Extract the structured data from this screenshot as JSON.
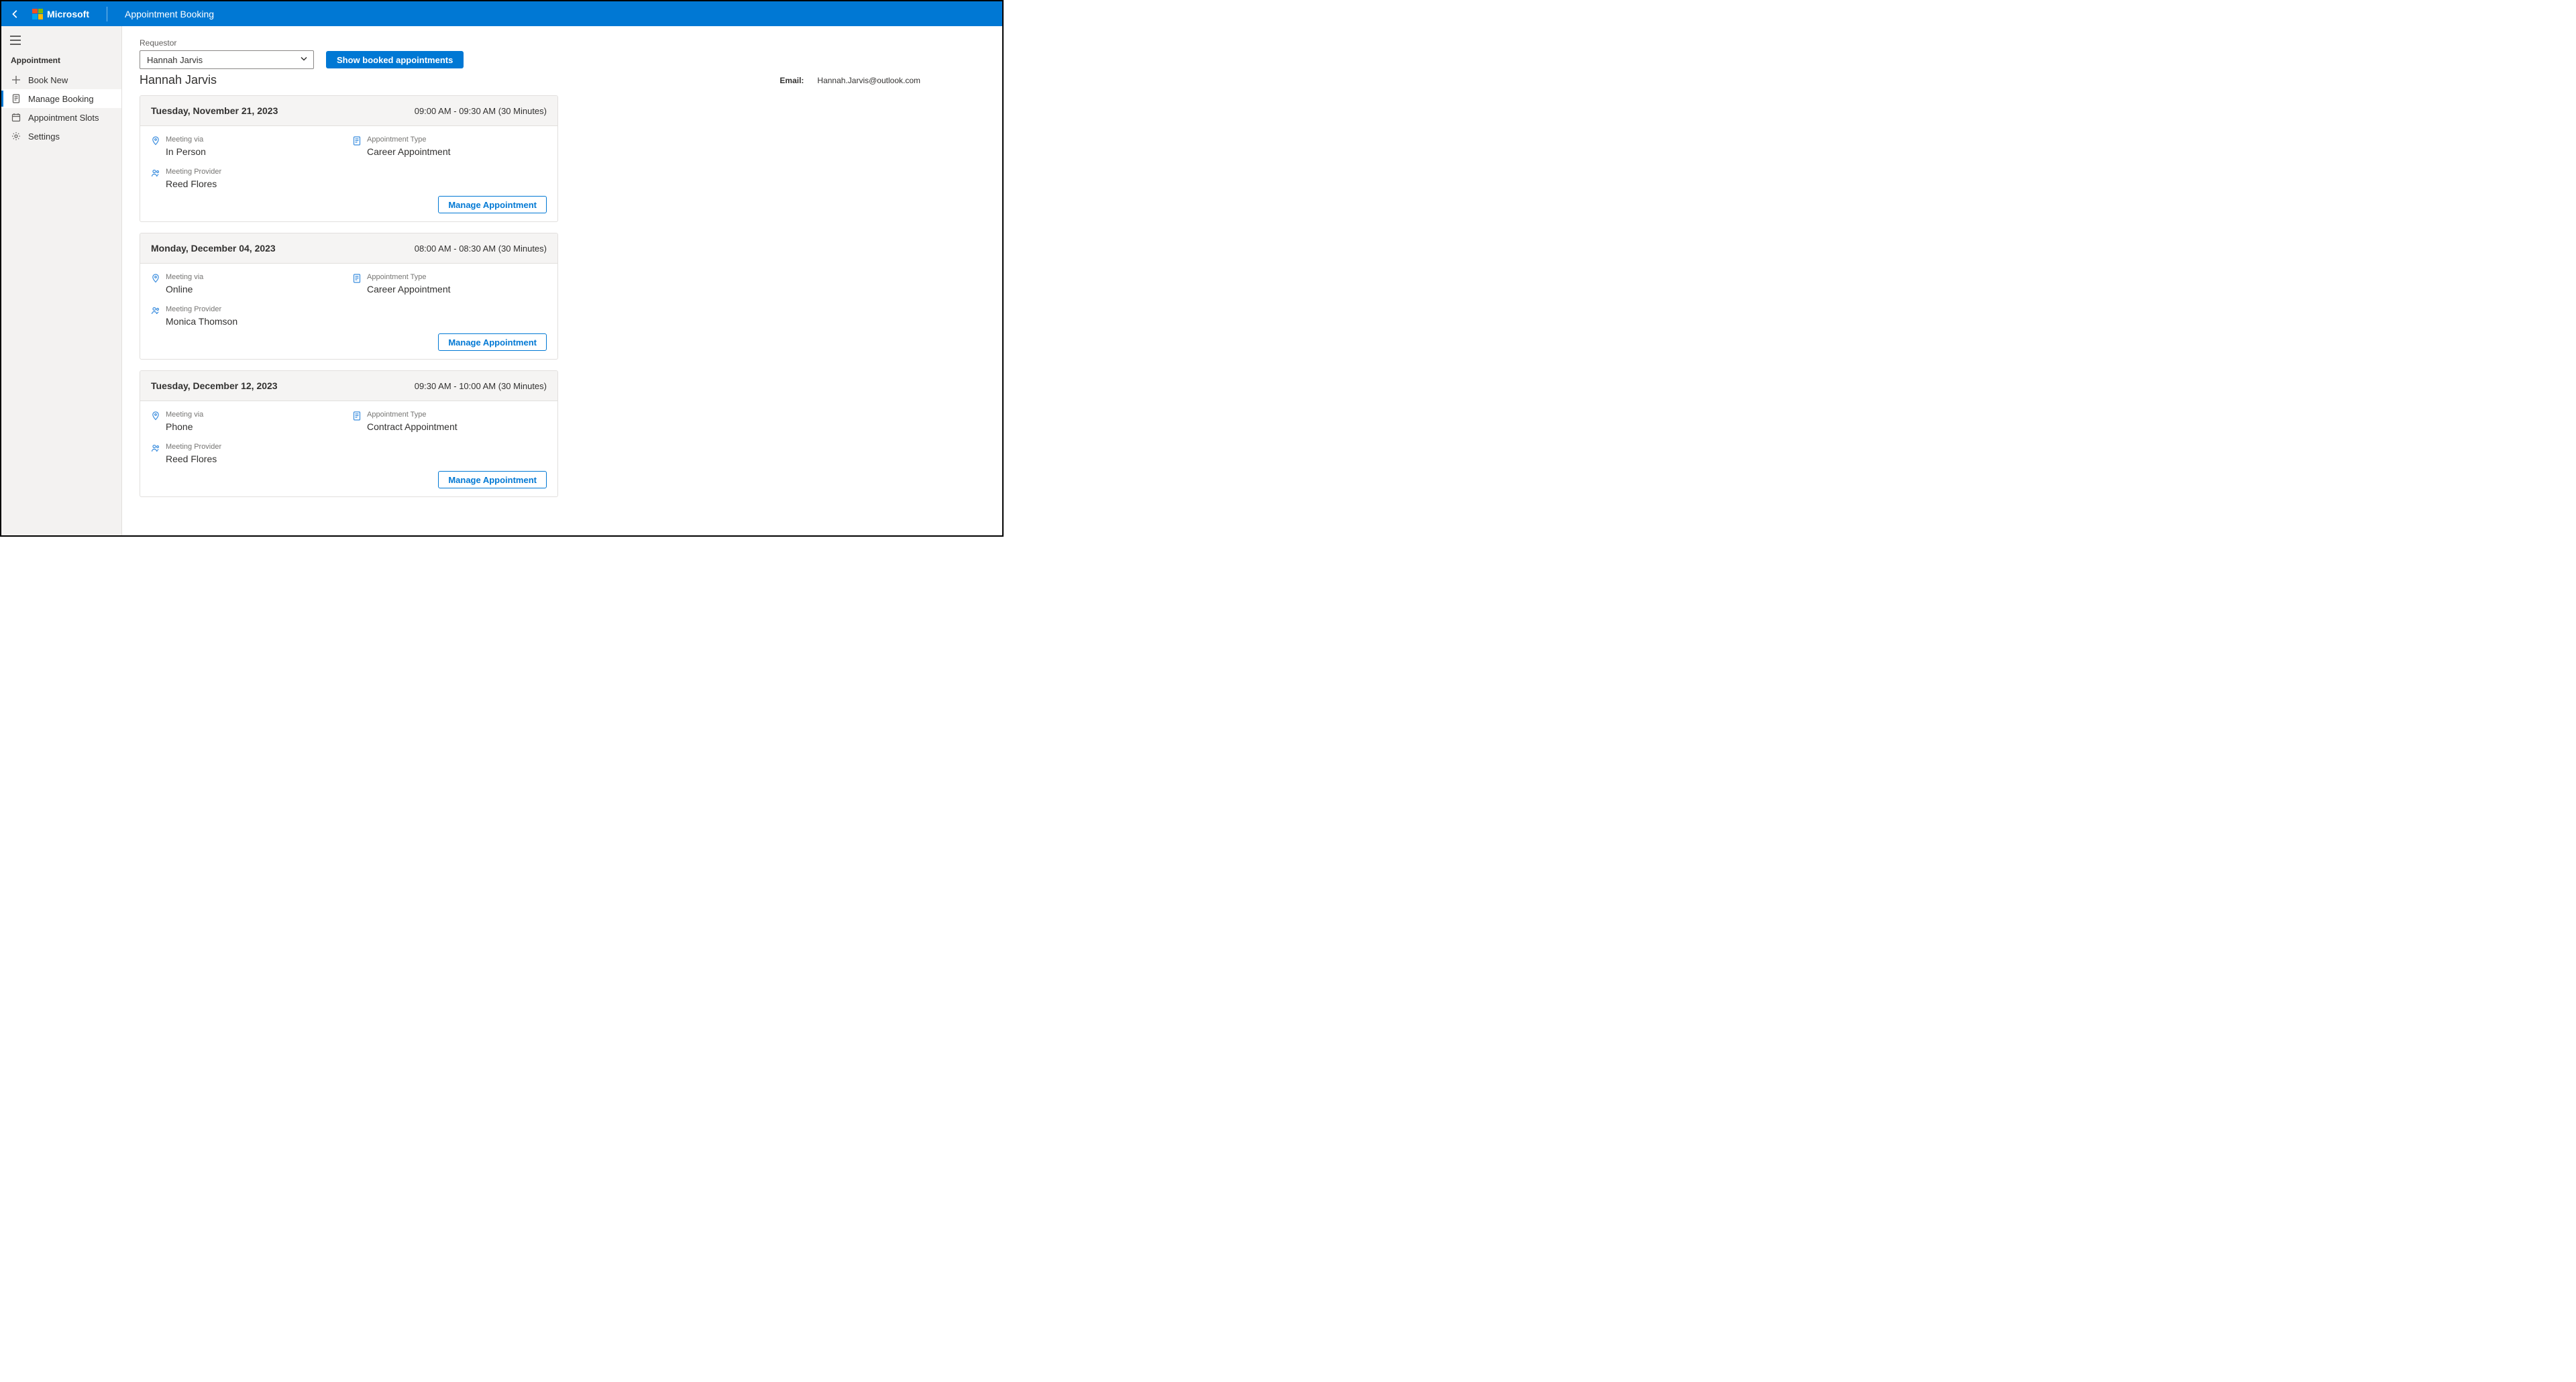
{
  "header": {
    "brand": "Microsoft",
    "app_title": "Appointment Booking"
  },
  "sidebar": {
    "group_label": "Appointment",
    "items": [
      {
        "icon": "plus",
        "label": "Book New"
      },
      {
        "icon": "document",
        "label": "Manage Booking"
      },
      {
        "icon": "calendar",
        "label": "Appointment Slots"
      },
      {
        "icon": "gear",
        "label": "Settings"
      }
    ]
  },
  "main": {
    "requestor_label": "Requestor",
    "requestor_select": "Hannah Jarvis",
    "show_booked_btn": "Show booked appointments",
    "requestor_name": "Hannah Jarvis",
    "email_label": "Email:",
    "email_value": "Hannah.Jarvis@outlook.com",
    "field_labels": {
      "meeting_via": "Meeting via",
      "appointment_type": "Appointment Type",
      "meeting_provider": "Meeting Provider"
    },
    "manage_btn": "Manage Appointment",
    "cards": [
      {
        "date": "Tuesday, November 21, 2023",
        "time": "09:00 AM - 09:30 AM (30 Minutes)",
        "meeting_via": "In Person",
        "appointment_type": "Career Appointment",
        "meeting_provider": "Reed Flores"
      },
      {
        "date": "Monday, December 04, 2023",
        "time": "08:00 AM - 08:30 AM (30 Minutes)",
        "meeting_via": "Online",
        "appointment_type": "Career Appointment",
        "meeting_provider": "Monica Thomson"
      },
      {
        "date": "Tuesday, December 12, 2023",
        "time": "09:30 AM - 10:00 AM (30 Minutes)",
        "meeting_via": "Phone",
        "appointment_type": "Contract Appointment",
        "meeting_provider": "Reed Flores"
      }
    ]
  }
}
